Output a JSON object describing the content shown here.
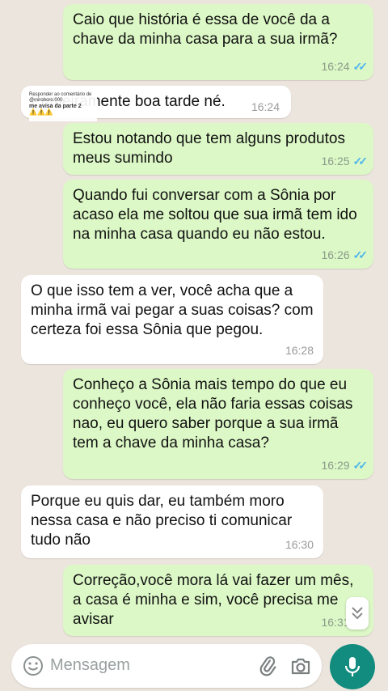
{
  "messages": [
    {
      "dir": "out",
      "text": "Caio que história é essa de você da a chave da minha casa para a sua irmã?",
      "time": "16:24",
      "read": true
    },
    {
      "dir": "in",
      "text": "Primeiramente boa tarde né.",
      "time": "16:24"
    },
    {
      "dir": "out",
      "text": "Estou notando que tem alguns produtos meus sumindo",
      "time": "16:25",
      "read": true
    },
    {
      "dir": "out",
      "text": "Quando fui conversar com a Sônia por acaso ela me soltou que sua irmã tem ido na minha casa quando eu não estou.",
      "time": "16:26",
      "read": true
    },
    {
      "dir": "in",
      "text": "O que isso tem a ver, você acha que a minha irmã vai pegar a suas coisas? com certeza foi essa Sônia que pegou.",
      "time": "16:28"
    },
    {
      "dir": "out",
      "text": "Conheço a Sônia mais tempo do que eu conheço você, ela não faria essas coisas nao, eu quero saber porque a sua irmã tem a chave da minha casa?",
      "time": "16:29",
      "read": true
    },
    {
      "dir": "in",
      "text": "Porque eu quis dar, eu também moro nessa casa e não preciso ti comunicar tudo não",
      "time": "16:30"
    },
    {
      "dir": "out",
      "text": "Correção,você mora lá vai fazer um mês, a casa é minha e sim, você precisa me avisar",
      "time": "16:31",
      "read": true
    }
  ],
  "overlay": {
    "text": "Responder ao comentário de @miroboro.000",
    "title": "me avisa da parte 2",
    "emoji": "⚠️⚠️⚠️"
  },
  "composer": {
    "placeholder": "Mensagem"
  },
  "icons": {
    "emoji": "smiley-icon",
    "attach": "paperclip-icon",
    "camera": "camera-icon",
    "mic": "microphone-icon",
    "scroll": "double-chevron-down-icon"
  },
  "colors": {
    "outgoing": "#dcf8c6",
    "incoming": "#ffffff",
    "accent": "#128c7e",
    "read_ticks": "#4fb6ec"
  }
}
